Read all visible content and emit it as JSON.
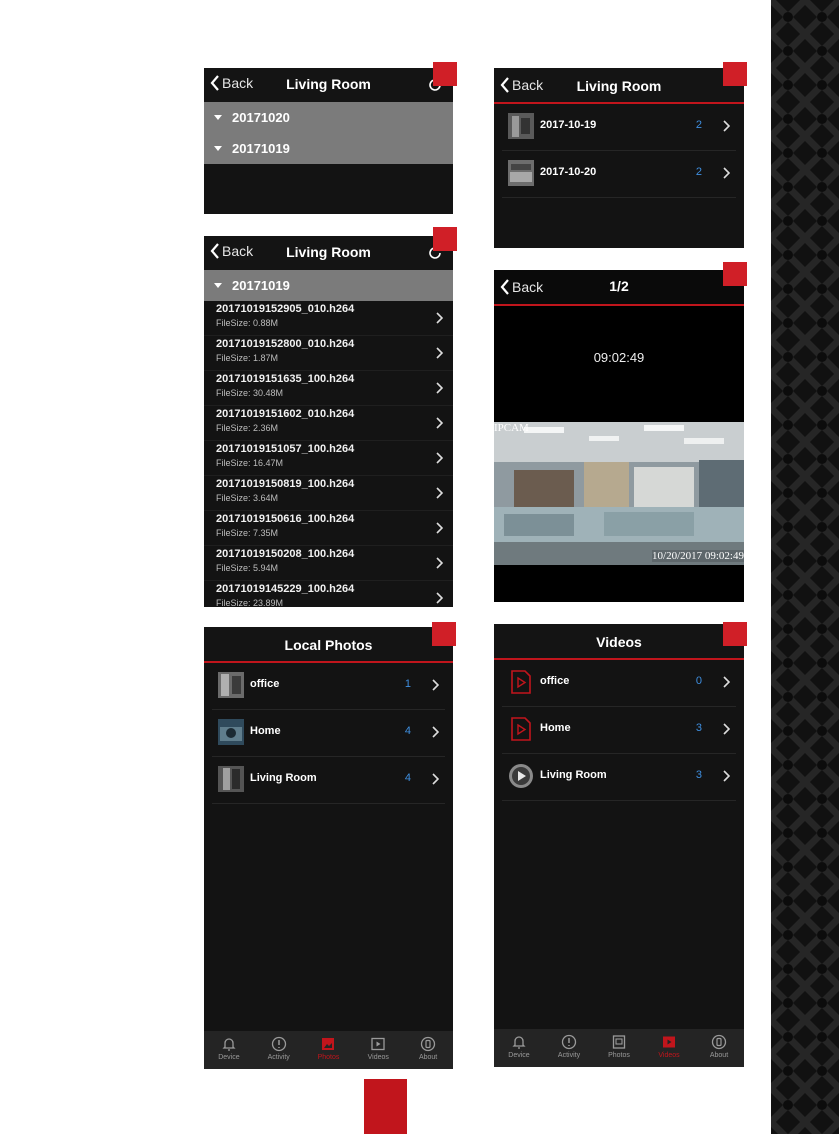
{
  "colors": {
    "accent": "#c1151c",
    "count_blue": "#3f8fe0",
    "group_gray": "#7b7b7b"
  },
  "screen_a": {
    "back_label": "Back",
    "title": "Living Room",
    "groups": [
      "20171020",
      "20171019"
    ]
  },
  "screen_b": {
    "back_label": "Back",
    "title": "Living Room",
    "group": "20171019",
    "files": [
      {
        "name": "20171019152905_010.h264",
        "size": "FileSize: 0.88M"
      },
      {
        "name": "20171019152800_010.h264",
        "size": "FileSize: 1.87M"
      },
      {
        "name": "20171019151635_100.h264",
        "size": "FileSize: 30.48M"
      },
      {
        "name": "20171019151602_010.h264",
        "size": "FileSize: 2.36M"
      },
      {
        "name": "20171019151057_100.h264",
        "size": "FileSize: 16.47M"
      },
      {
        "name": "20171019150819_100.h264",
        "size": "FileSize: 3.64M"
      },
      {
        "name": "20171019150616_100.h264",
        "size": "FileSize: 7.35M"
      },
      {
        "name": "20171019150208_100.h264",
        "size": "FileSize: 5.94M"
      },
      {
        "name": "20171019145229_100.h264",
        "size": "FileSize: 23.89M"
      }
    ]
  },
  "screen_c": {
    "back_label": "Back",
    "title": "Living Room",
    "rows": [
      {
        "label": "2017-10-19",
        "count": "2"
      },
      {
        "label": "2017-10-20",
        "count": "2"
      }
    ]
  },
  "screen_d": {
    "back_label": "Back",
    "title": "1/2",
    "time": "09:02:49",
    "overlay_brand": "IPCAM",
    "overlay_timestamp": "10/20/2017 09:02:49"
  },
  "screen_e": {
    "title": "Local Photos",
    "rows": [
      {
        "label": "office",
        "count": "1"
      },
      {
        "label": "Home",
        "count": "4"
      },
      {
        "label": "Living Room",
        "count": "4"
      }
    ],
    "tabs": [
      "Device",
      "Activity",
      "Photos",
      "Videos",
      "About"
    ]
  },
  "screen_f": {
    "title": "Videos",
    "rows": [
      {
        "label": "office",
        "count": "0"
      },
      {
        "label": "Home",
        "count": "3"
      },
      {
        "label": "Living Room",
        "count": "3"
      }
    ],
    "tabs": [
      "Device",
      "Activity",
      "Photos",
      "Videos",
      "About"
    ]
  }
}
